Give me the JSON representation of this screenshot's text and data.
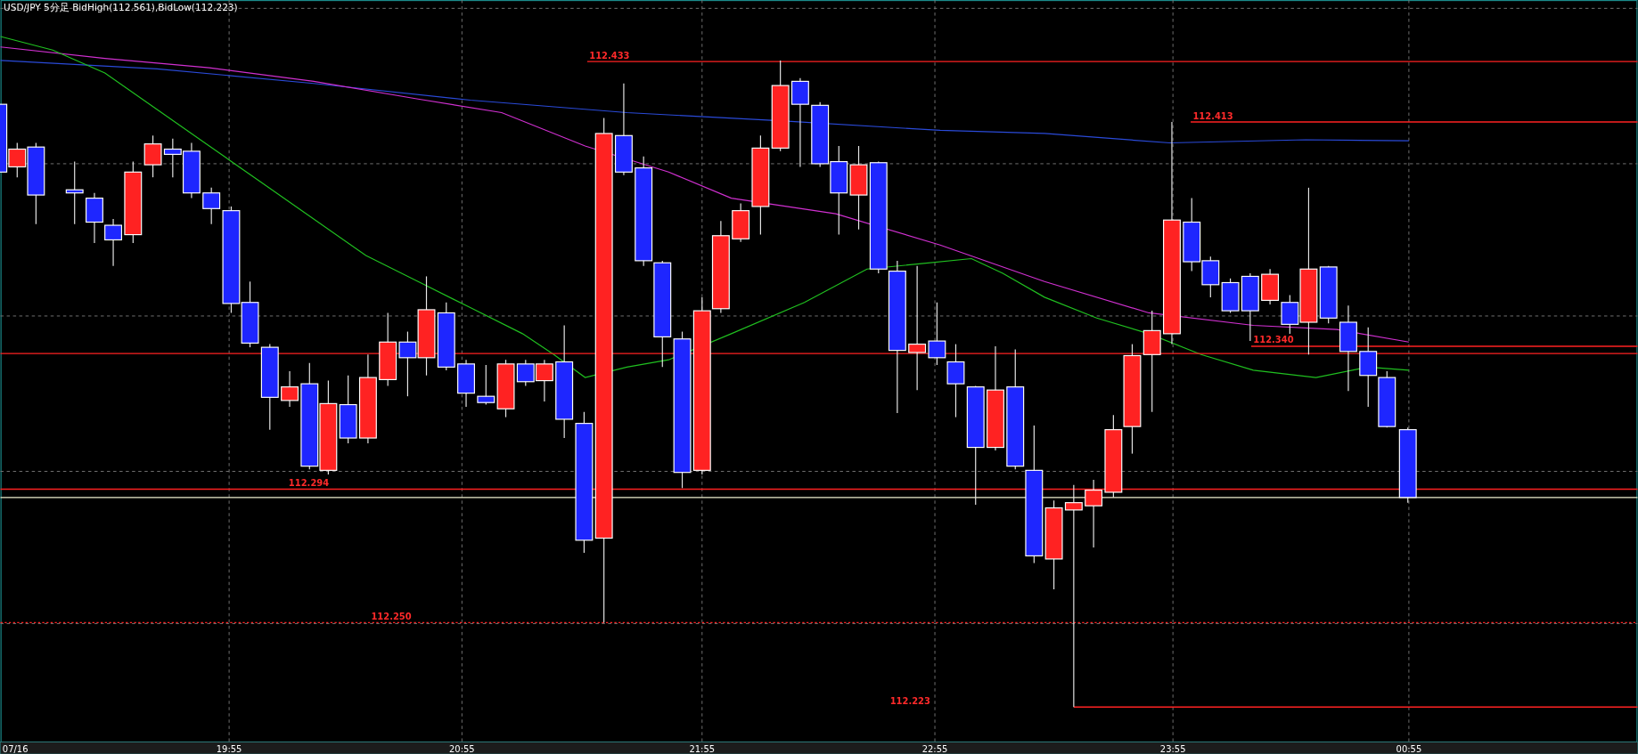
{
  "chart_title": "USD/JPY 5分足  BidHigh(112.561),BidLow(112.223)",
  "price_lines": [
    {
      "label": "112.433",
      "kind": "solid"
    },
    {
      "label": "112.413",
      "kind": "solid"
    },
    {
      "label": "112.340",
      "kind": "solid"
    },
    {
      "label": "112.294",
      "kind": "solid"
    },
    {
      "label": "112.250",
      "kind": "dotted"
    },
    {
      "label": "112.223",
      "kind": "solid"
    }
  ],
  "time_axis": [
    "07/16",
    "19:55",
    "20:55",
    "21:55",
    "22:55",
    "23:55",
    "00:55"
  ]
}
